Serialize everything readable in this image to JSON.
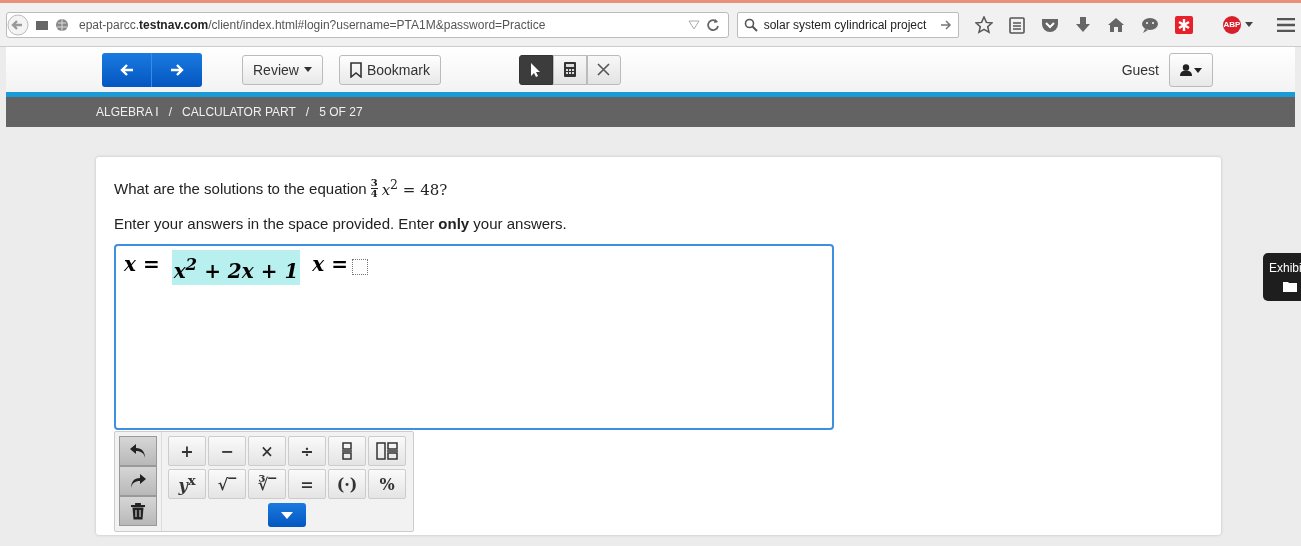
{
  "browser": {
    "url_prefix": "epat-parcc.",
    "url_domain": "testnav.com",
    "url_rest": "/client/index.html#login?username=PTA1M&password=Practice",
    "search": "solar system cylindrical project",
    "adblock_badge": "ABP"
  },
  "header": {
    "review": "Review",
    "bookmark": "Bookmark",
    "tools": [
      {
        "kind": "pointer",
        "selected": true
      },
      {
        "kind": "calculator",
        "selected": false
      },
      {
        "kind": "close",
        "selected": false
      }
    ],
    "user": "Guest"
  },
  "breadcrumb": [
    "ALGEBRA I",
    "/",
    "CALCULATOR PART",
    "/",
    "5 OF 27"
  ],
  "question": {
    "prefix": "What are the solutions to the equation",
    "numerator": "3",
    "denominator": "4",
    "suffix": "*x*$^{2}$ = 48?",
    "instruction": "Enter your answers in the space provided. Enter **only** your answers."
  },
  "answer": [
    {
      "text": "x =",
      "highlighted": false
    },
    {
      "text": "x$^{2}$ + 2x + 1",
      "highlighted": true
    },
    {
      "text": "x =",
      "highlighted": false
    }
  ],
  "keypad": {
    "keys": [
      {
        "kind": "text",
        "label": "+"
      },
      {
        "kind": "text",
        "label": "−"
      },
      {
        "kind": "text",
        "label": "×"
      },
      {
        "kind": "text",
        "label": "÷"
      },
      {
        "kind": "fraction"
      },
      {
        "kind": "mixed-fraction"
      },
      {
        "kind": "text",
        "label": "*y*$^{x}$"
      },
      {
        "kind": "text",
        "label": "√‾"
      },
      {
        "kind": "text",
        "label": "∛‾"
      },
      {
        "kind": "text",
        "label": "="
      },
      {
        "kind": "text",
        "label": "(·)"
      },
      {
        "kind": "text",
        "label": "%"
      }
    ]
  },
  "exhibit": "Exhibi"
}
